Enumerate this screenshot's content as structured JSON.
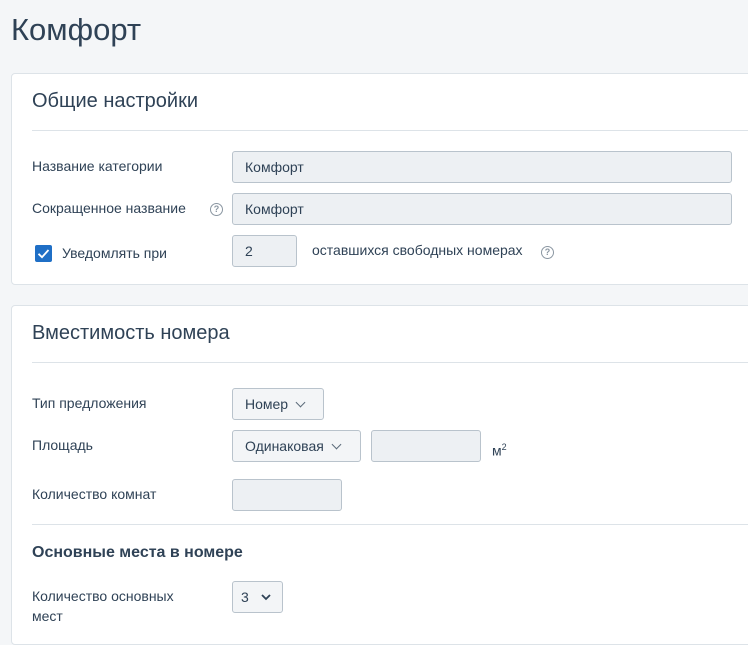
{
  "page": {
    "title": "Комфорт"
  },
  "general": {
    "title": "Общие настройки",
    "category_name_label": "Название категории",
    "category_name_value": "Комфорт",
    "short_name_label": "Сокращенное название",
    "short_name_value": "Комфорт",
    "notify_label": "Уведомлять при",
    "notify_checked": true,
    "notify_value": "2",
    "notify_suffix": "оставшихся свободных номерах"
  },
  "capacity": {
    "title": "Вместимость номера",
    "offer_type_label": "Тип предложения",
    "offer_type_value": "Номер",
    "area_label": "Площадь",
    "area_type_value": "Одинаковая",
    "area_value": "",
    "area_unit": "м",
    "area_unit_sup": "2",
    "rooms_label": "Количество комнат",
    "rooms_value": "",
    "main_places_title": "Основные места в номере",
    "main_places_label_line1": "Количество основных",
    "main_places_label_line2": "мест",
    "main_places_value": "3"
  },
  "colors": {
    "accent": "#1f6fc6",
    "background": "#f4f6f8",
    "panel": "#ffffff",
    "input_bg": "#edf0f3"
  },
  "icons": {
    "help": "question-circle-icon",
    "check": "check-icon",
    "dropdown": "chevron-down-icon"
  }
}
